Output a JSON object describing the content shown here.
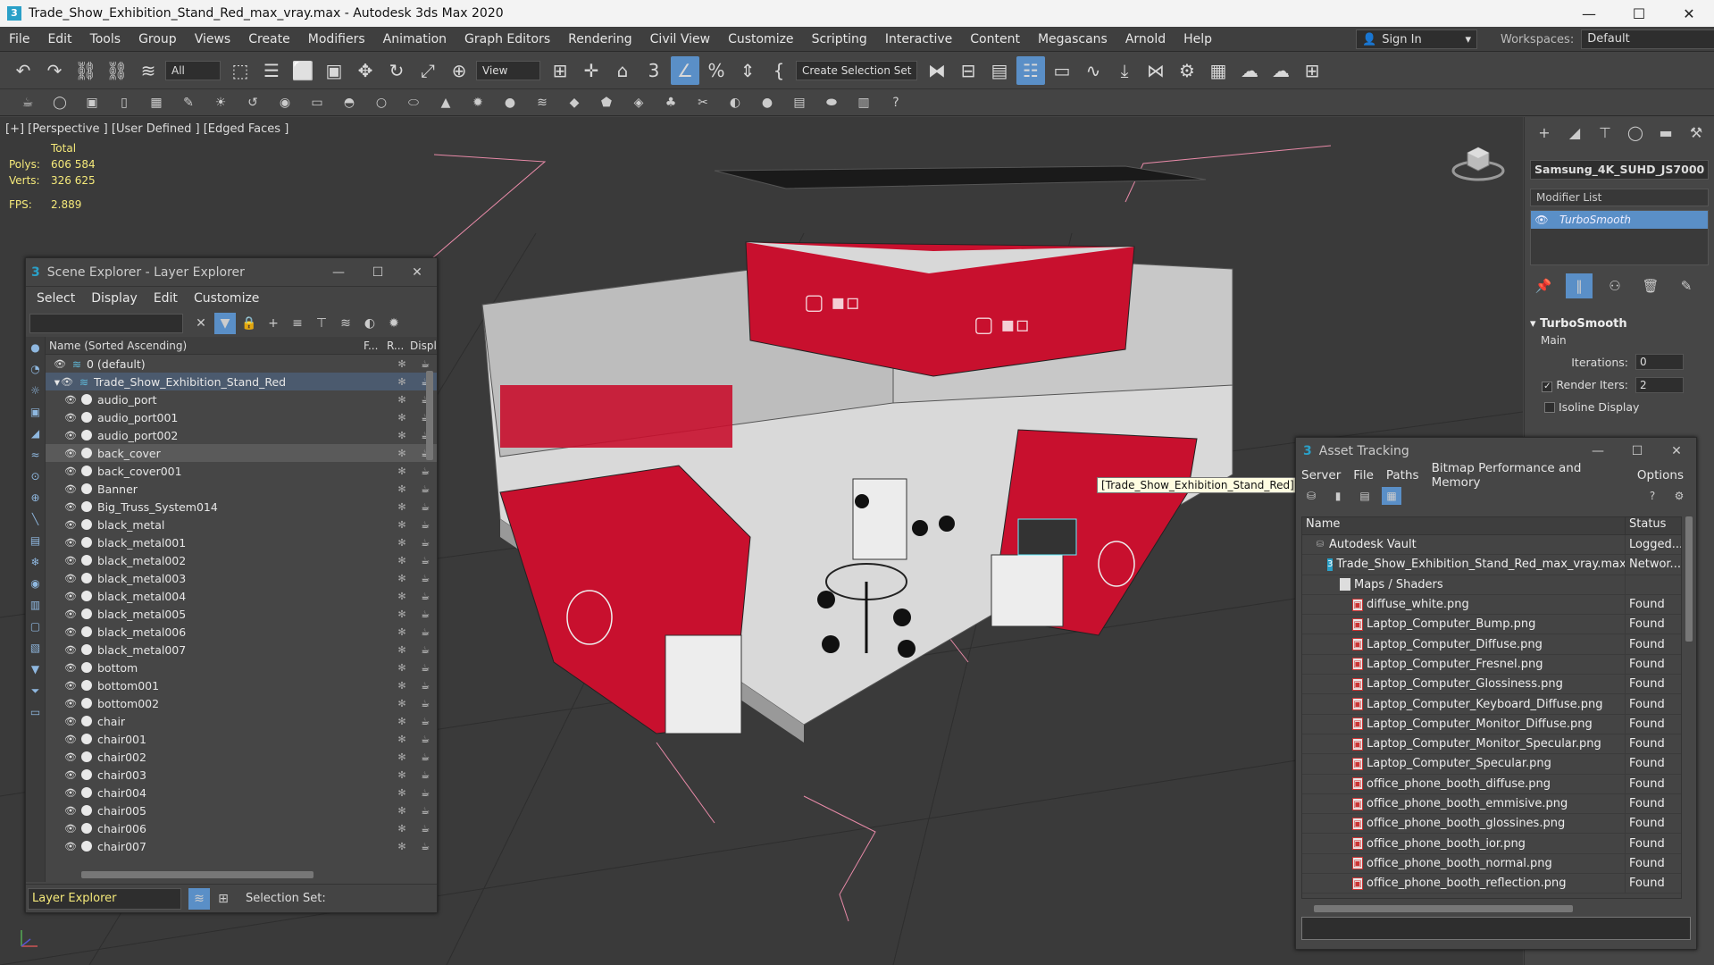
{
  "window": {
    "title": "Trade_Show_Exhibition_Stand_Red_max_vray.max - Autodesk 3ds Max 2020"
  },
  "menu": [
    "File",
    "Edit",
    "Tools",
    "Group",
    "Views",
    "Create",
    "Modifiers",
    "Animation",
    "Graph Editors",
    "Rendering",
    "Civil View",
    "Customize",
    "Scripting",
    "Interactive",
    "Content",
    "Megascans",
    "Arnold",
    "Help"
  ],
  "signin_label": "Sign In",
  "workspaces": {
    "label": "Workspaces:",
    "value": "Default"
  },
  "toolbar": {
    "filter_value": "All",
    "ref_coord_value": "View",
    "selection_set_label": "Create Selection Set"
  },
  "viewport": {
    "label": "[+] [Perspective ] [User Defined ] [Edged Faces ]",
    "stats": {
      "total_label": "Total",
      "polys_label": "Polys:",
      "polys_value": "606 584",
      "verts_label": "Verts:",
      "verts_value": "326 625",
      "fps_label": "FPS:",
      "fps_value": "2.889"
    },
    "tooltip": "[Trade_Show_Exhibition_Stand_Red] Exhibition_Stand"
  },
  "scene_explorer": {
    "title": "Scene Explorer - Layer Explorer",
    "menu": [
      "Select",
      "Display",
      "Edit",
      "Customize"
    ],
    "columns": {
      "name": "Name (Sorted Ascending)",
      "frozen": "F...",
      "render": "R...",
      "display": "Displ"
    },
    "layers": [
      "0 (default)",
      "Trade_Show_Exhibition_Stand_Red"
    ],
    "objects": [
      "audio_port",
      "audio_port001",
      "audio_port002",
      "back_cover",
      "back_cover001",
      "Banner",
      "Big_Truss_System014",
      "black_metal",
      "black_metal001",
      "black_metal002",
      "black_metal003",
      "black_metal004",
      "black_metal005",
      "black_metal006",
      "black_metal007",
      "bottom",
      "bottom001",
      "bottom002",
      "chair",
      "chair001",
      "chair002",
      "chair003",
      "chair004",
      "chair005",
      "chair006",
      "chair007"
    ],
    "footer_layer": "Layer Explorer",
    "footer_selection": "Selection Set:"
  },
  "command_panel": {
    "object_name": "Samsung_4K_SUHD_JS7000",
    "modifier_list": "Modifier List",
    "modifier": "TurboSmooth",
    "rollout_title": "TurboSmooth",
    "rollout_sub": "Main",
    "iterations_label": "Iterations:",
    "iterations_value": "0",
    "render_iters_label": "Render Iters:",
    "render_iters_value": "2",
    "isoline_label": "Isoline Display"
  },
  "asset_tracking": {
    "title": "Asset Tracking",
    "menu": [
      "Server",
      "File",
      "Paths",
      "Bitmap Performance and Memory",
      "Options"
    ],
    "columns": {
      "name": "Name",
      "status": "Status"
    },
    "rows": [
      {
        "name": "Autodesk Vault",
        "status": "Logged...",
        "type": "vault",
        "indent": 0
      },
      {
        "name": "Trade_Show_Exhibition_Stand_Red_max_vray.max",
        "status": "Networ...",
        "type": "max",
        "indent": 1
      },
      {
        "name": "Maps / Shaders",
        "status": "",
        "type": "folder",
        "indent": 2
      },
      {
        "name": "diffuse_white.png",
        "status": "Found",
        "type": "img",
        "indent": 3
      },
      {
        "name": "Laptop_Computer_Bump.png",
        "status": "Found",
        "type": "img",
        "indent": 3
      },
      {
        "name": "Laptop_Computer_Diffuse.png",
        "status": "Found",
        "type": "img",
        "indent": 3
      },
      {
        "name": "Laptop_Computer_Fresnel.png",
        "status": "Found",
        "type": "img",
        "indent": 3
      },
      {
        "name": "Laptop_Computer_Glossiness.png",
        "status": "Found",
        "type": "img",
        "indent": 3
      },
      {
        "name": "Laptop_Computer_Keyboard_Diffuse.png",
        "status": "Found",
        "type": "img",
        "indent": 3
      },
      {
        "name": "Laptop_Computer_Monitor_Diffuse.png",
        "status": "Found",
        "type": "img",
        "indent": 3
      },
      {
        "name": "Laptop_Computer_Monitor_Specular.png",
        "status": "Found",
        "type": "img",
        "indent": 3
      },
      {
        "name": "Laptop_Computer_Specular.png",
        "status": "Found",
        "type": "img",
        "indent": 3
      },
      {
        "name": "office_phone_booth_diffuse.png",
        "status": "Found",
        "type": "img",
        "indent": 3
      },
      {
        "name": "office_phone_booth_emmisive.png",
        "status": "Found",
        "type": "img",
        "indent": 3
      },
      {
        "name": "office_phone_booth_glossines.png",
        "status": "Found",
        "type": "img",
        "indent": 3
      },
      {
        "name": "office_phone_booth_ior.png",
        "status": "Found",
        "type": "img",
        "indent": 3
      },
      {
        "name": "office_phone_booth_normal.png",
        "status": "Found",
        "type": "img",
        "indent": 3
      },
      {
        "name": "office_phone_booth_reflection.png",
        "status": "Found",
        "type": "img",
        "indent": 3
      }
    ]
  },
  "colors": {
    "accent": "#5a8fc7",
    "stand_red": "#c8102e",
    "stats_yellow": "#f5e97a"
  }
}
